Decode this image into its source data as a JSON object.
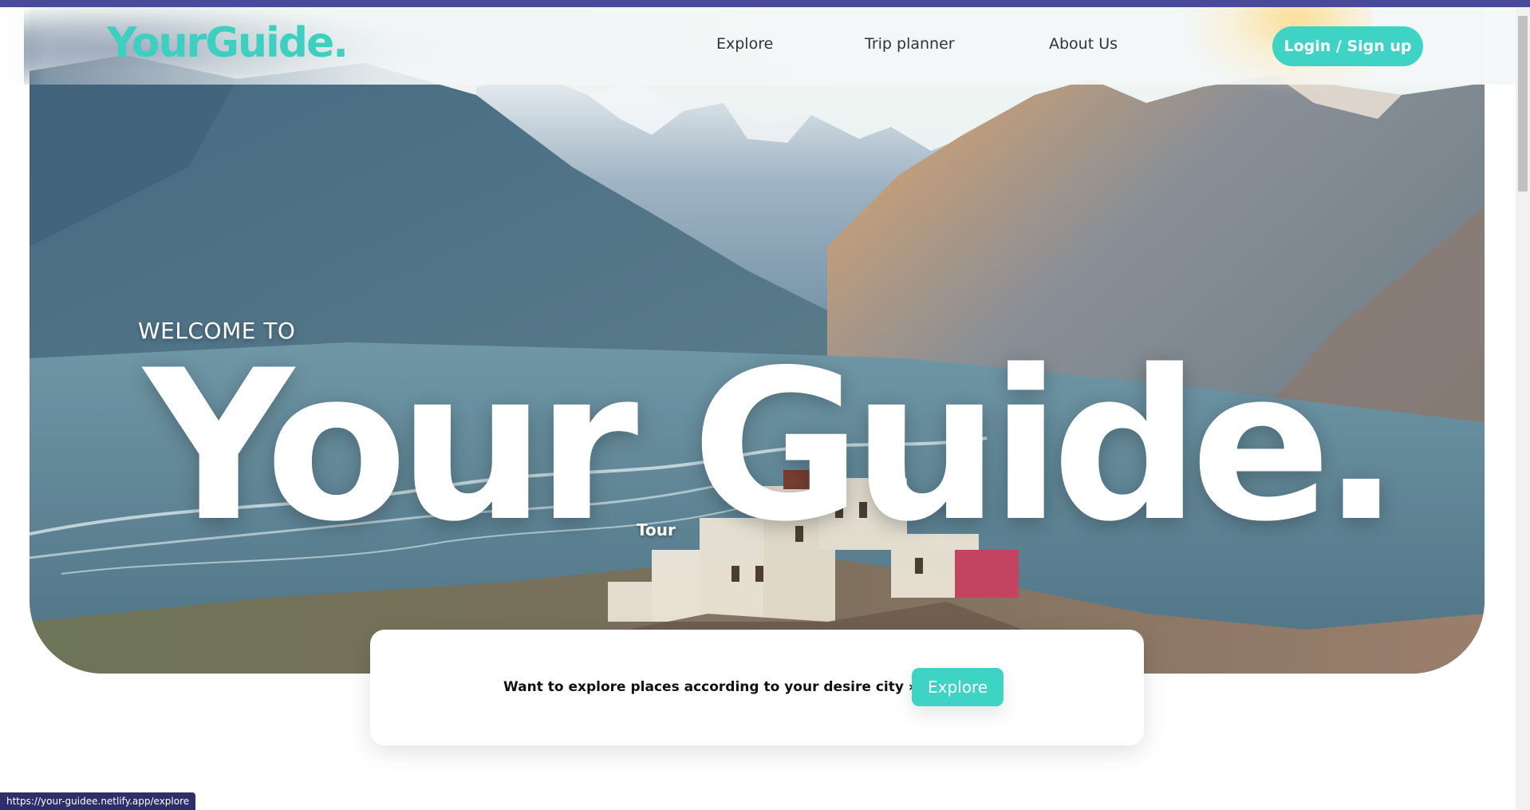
{
  "colors": {
    "accent": "#3fd3c5",
    "logo": "#3fcfc0",
    "top_strip": "#4a4a9a",
    "status_bar": "#2c2f6a"
  },
  "header": {
    "logo": "YourGuide.",
    "nav": [
      {
        "label": "Explore"
      },
      {
        "label": "Trip planner"
      },
      {
        "label": "About Us"
      }
    ],
    "login_label": "Login / Sign up"
  },
  "hero": {
    "welcome": "WELCOME TO",
    "title": "Your Guide.",
    "tour_label": "Tour"
  },
  "explore_card": {
    "text": "Want to explore places according to your desire city »»",
    "button_label": "Explore"
  },
  "status_bar": {
    "url": "https://your-guidee.netlify.app/explore"
  }
}
